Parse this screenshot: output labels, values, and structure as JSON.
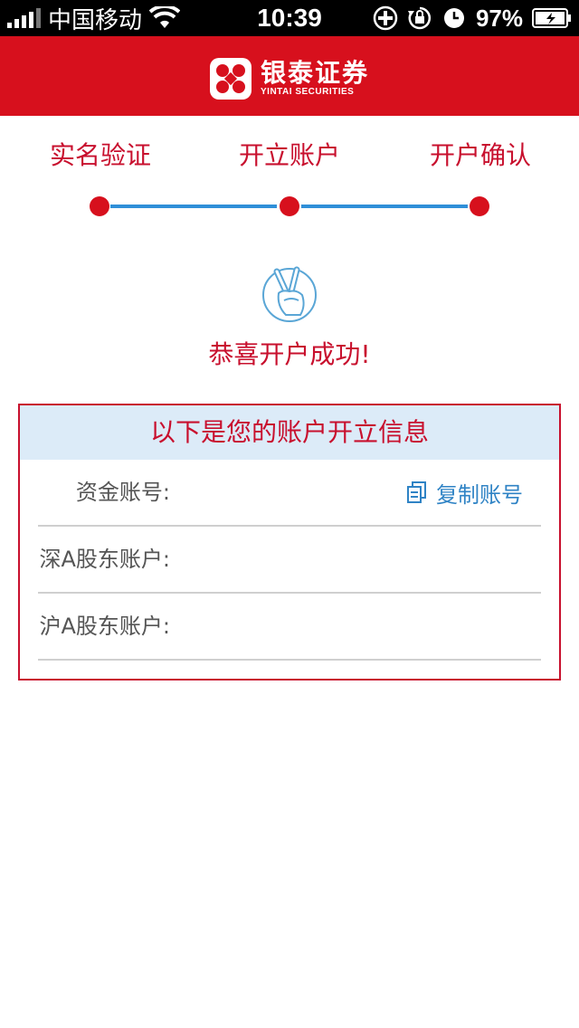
{
  "statusbar": {
    "carrier": "中国移动",
    "time": "10:39",
    "battery": "97%",
    "icons": [
      "signal-icon",
      "wifi-icon",
      "add-circle-icon",
      "rotation-lock-icon",
      "clock-icon",
      "battery-icon"
    ]
  },
  "header": {
    "brand_cn": "银泰证券",
    "brand_en": "YINTAI SECURITIES",
    "color": "#d7101d"
  },
  "steps": [
    {
      "label": "实名验证"
    },
    {
      "label": "开立账户"
    },
    {
      "label": "开户确认"
    }
  ],
  "success": {
    "message": "恭喜开户成功!"
  },
  "account_info": {
    "title": "以下是您的账户开立信息",
    "rows": [
      {
        "label": "资金账号:",
        "value": ""
      },
      {
        "label": "深A股东账户:",
        "value": ""
      },
      {
        "label": "沪A股东账户:",
        "value": ""
      }
    ],
    "copy_label": "复制账号"
  },
  "colors": {
    "accent_red": "#c8102e",
    "progress_blue": "#2f8fd8",
    "link_blue": "#2f83c5",
    "info_header_bg": "#dcebf8"
  }
}
